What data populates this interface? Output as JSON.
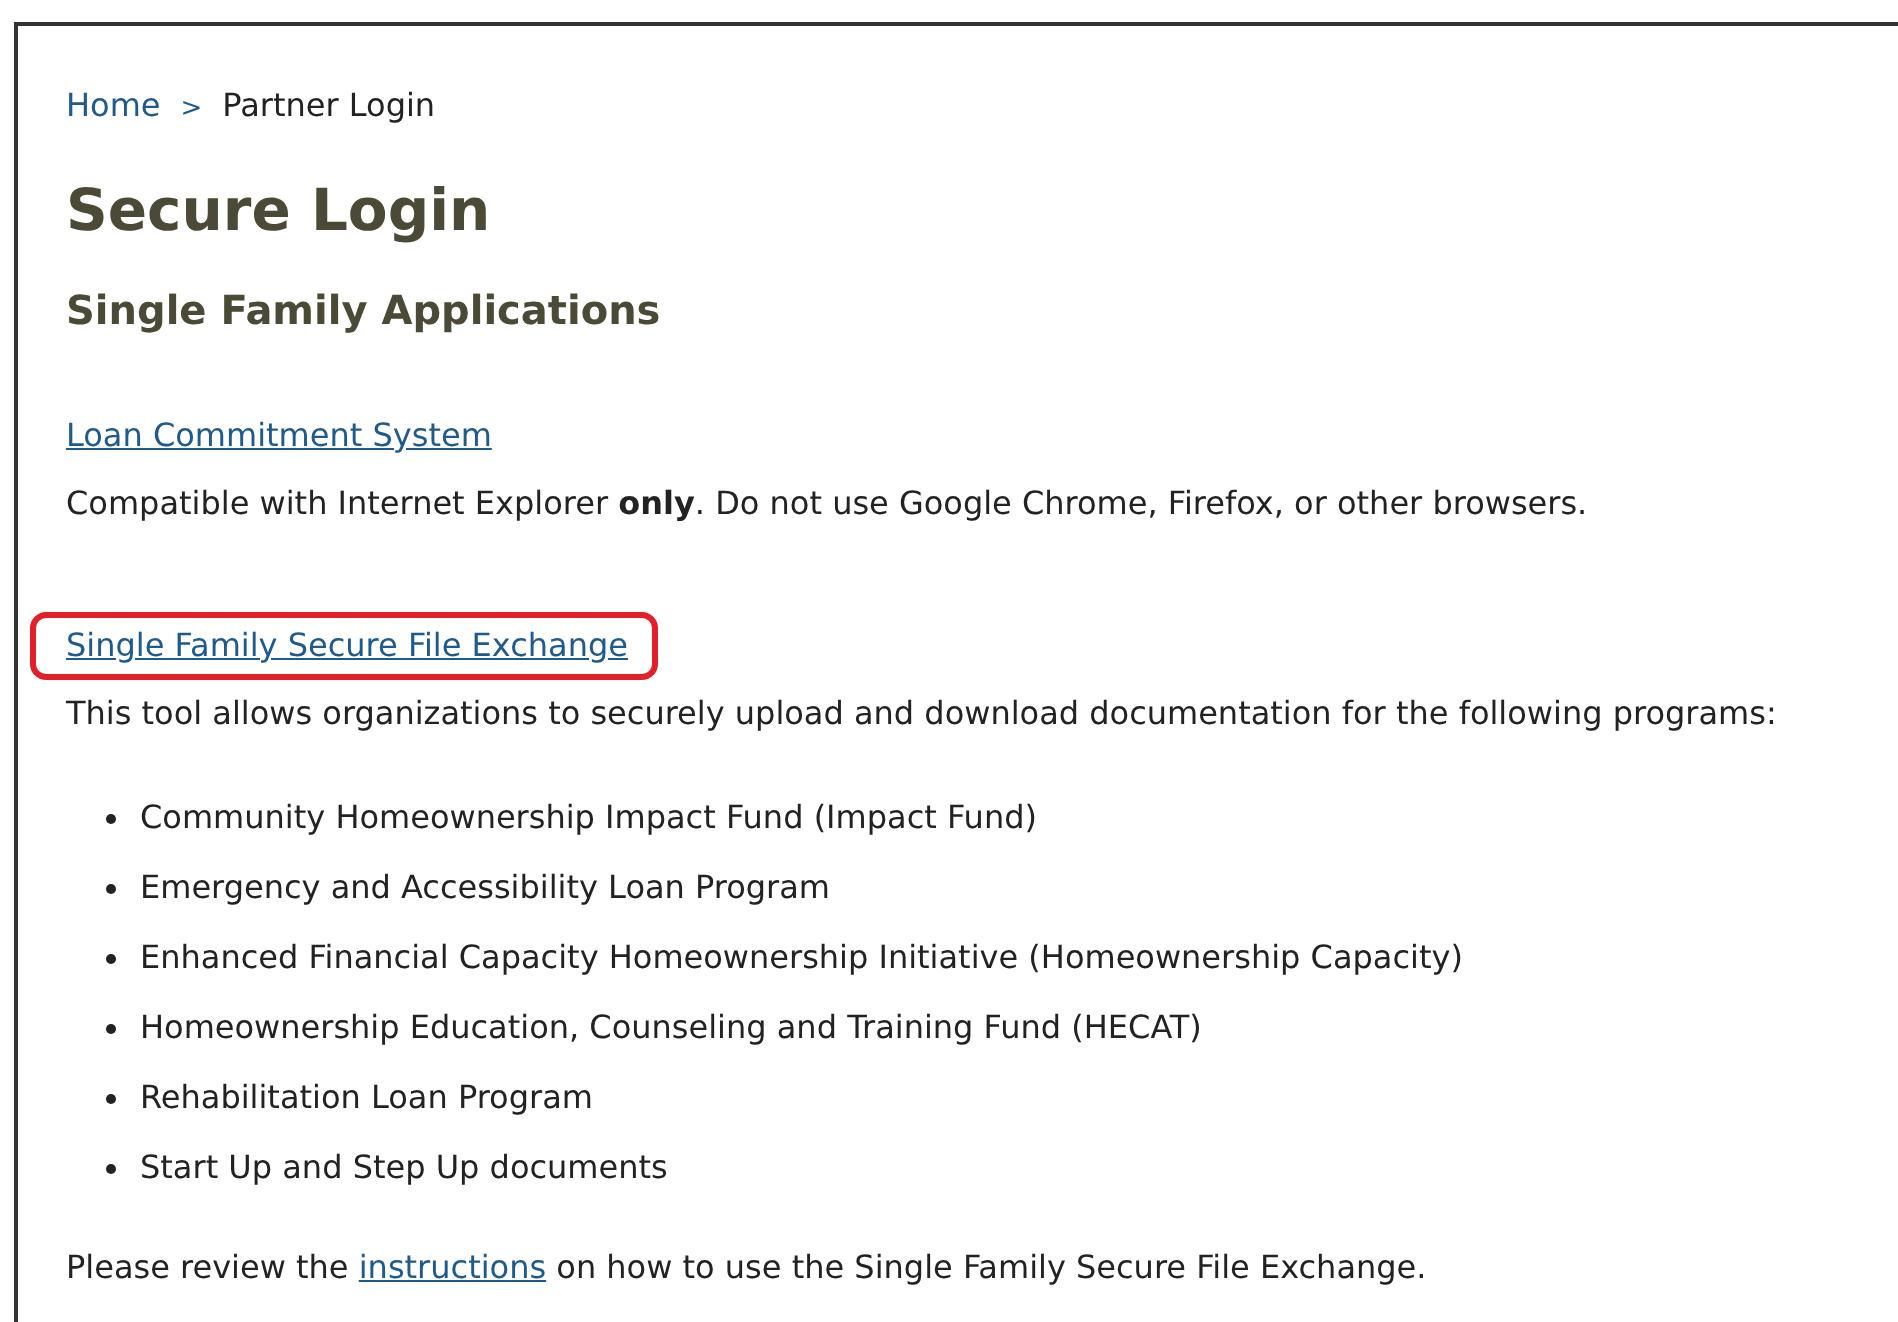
{
  "breadcrumb": {
    "separator": ">",
    "items": [
      {
        "label": "Home",
        "kind": "link"
      },
      {
        "label": "Partner Login",
        "kind": "current"
      }
    ]
  },
  "title": "Secure Login",
  "subtitle": "Single Family Applications",
  "sections": [
    {
      "link": {
        "label": "Loan Commitment System",
        "highlighted": false
      },
      "description": "Compatible with Internet Explorer **only**. Do not use Google Chrome, Firefox, or other browsers."
    },
    {
      "link": {
        "label": "Single Family Secure File Exchange",
        "highlighted": true
      },
      "description": "This tool allows organizations to securely upload and download documentation for the following programs:",
      "bullets": [
        "Community Homeownership Impact Fund (Impact Fund)",
        "Emergency and Accessibility Loan Program",
        "Enhanced Financial Capacity Homeownership Initiative (Homeownership Capacity)",
        "Homeownership Education, Counseling and Training Fund (HECAT)",
        "Rehabilitation Loan Program",
        "Start Up and Step Up documents"
      ]
    }
  ],
  "note": {
    "before": "Please review the",
    "link": "instructions",
    "after": "on how to use the Single Family Secure File Exchange."
  }
}
